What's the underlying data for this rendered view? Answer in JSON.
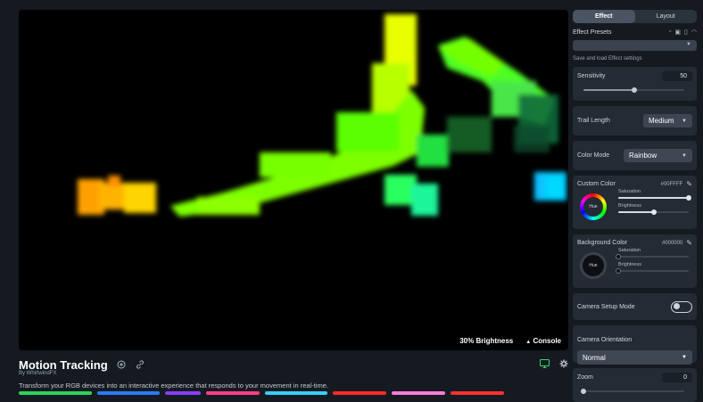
{
  "preview": {
    "brightness_text": "30% Brightness",
    "console_label": "Console",
    "console_icon": "triangle-up-icon"
  },
  "effect": {
    "title": "Motion Tracking",
    "author": "By WhirlwindFX",
    "description": "Transform your RGB devices into an interactive experience that responds to your movement in real-time."
  },
  "panel": {
    "tabs": [
      {
        "label": "Effect",
        "active": true
      },
      {
        "label": "Layout",
        "active": false
      }
    ],
    "presets_label": "Effect Presets",
    "presets_hint": "Save and load Effect settings",
    "sensitivity": {
      "label": "Sensitivity",
      "value": "50",
      "fraction": 0.5
    },
    "trail_length": {
      "label": "Trail Length",
      "value": "Medium"
    },
    "color_mode": {
      "label": "Color Mode",
      "value": "Rainbow"
    },
    "custom_color": {
      "label": "Custom Color",
      "hex": "#00FFFF",
      "hue_label": "Hue",
      "saturation_label": "Saturation",
      "saturation": 1.0,
      "brightness_label": "Brightness",
      "brightness": 0.5
    },
    "background_color": {
      "label": "Background Color",
      "hex": "#000000",
      "hue_label": "Hue",
      "saturation_label": "Saturation",
      "saturation": 0.0,
      "brightness_label": "Brightness",
      "brightness": 0.0
    },
    "camera_setup": {
      "label": "Camera Setup Mode",
      "on": false
    },
    "camera_orientation": {
      "label": "Camera Orientation",
      "value": "Normal"
    },
    "zoom": {
      "label": "Zoom",
      "value": "0",
      "fraction": 0.0
    }
  },
  "colors": {
    "accent": "#4a5462",
    "stripe": [
      "#2bd35a",
      "#2a7bff",
      "#8a3dff",
      "#ff3d8a",
      "#37d0ff",
      "#ff2a2a",
      "#ff7ad9",
      "#ff3030"
    ]
  }
}
